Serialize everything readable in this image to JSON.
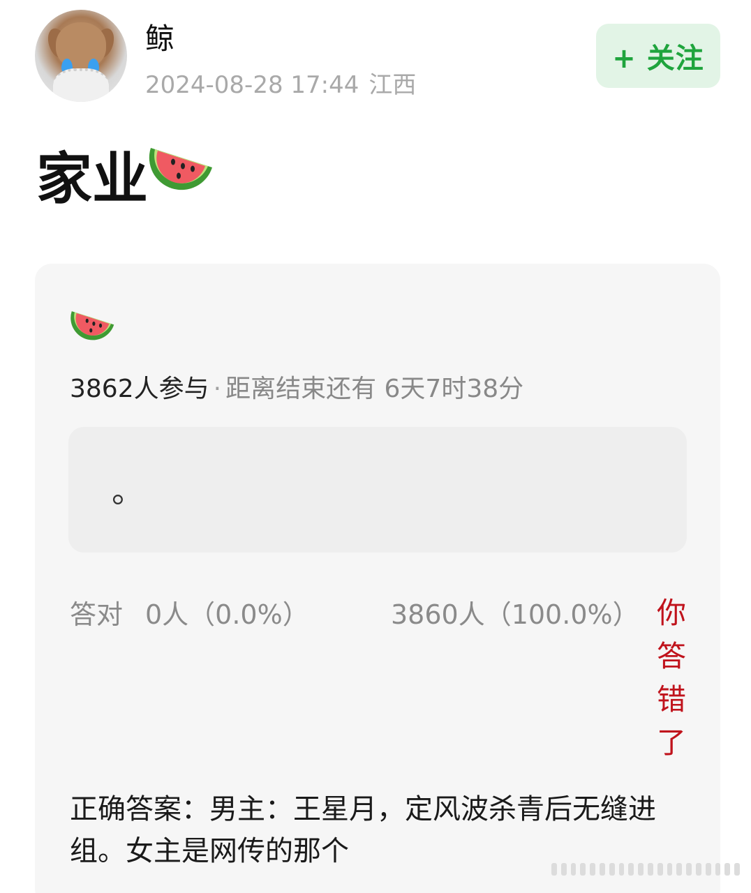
{
  "header": {
    "username": "鲸",
    "timestamp": "2024-08-28 17:44",
    "location": "江西",
    "follow_label": "+ 关注"
  },
  "post": {
    "title": "家业"
  },
  "quiz": {
    "participants": "3862人参与",
    "separator": "·",
    "deadline": "距离结束还有 6天7时38分",
    "option_text": "。",
    "correct_label": "答对",
    "correct_count": "0人（0.0%）",
    "wrong_count": "3860人（100.0%）",
    "wrong_tag": "你答错了",
    "answer": "正确答案：男主：王星月，定风波杀青后无缝进组。女主是网传的那个"
  },
  "colors": {
    "follow_bg": "#e2f4e6",
    "follow_text": "#1fa43d",
    "wrong_red": "#c0131c",
    "card_bg": "#f6f6f6"
  },
  "icons": {
    "title_emoji": "watermelon-icon",
    "card_emoji": "watermelon-icon"
  }
}
